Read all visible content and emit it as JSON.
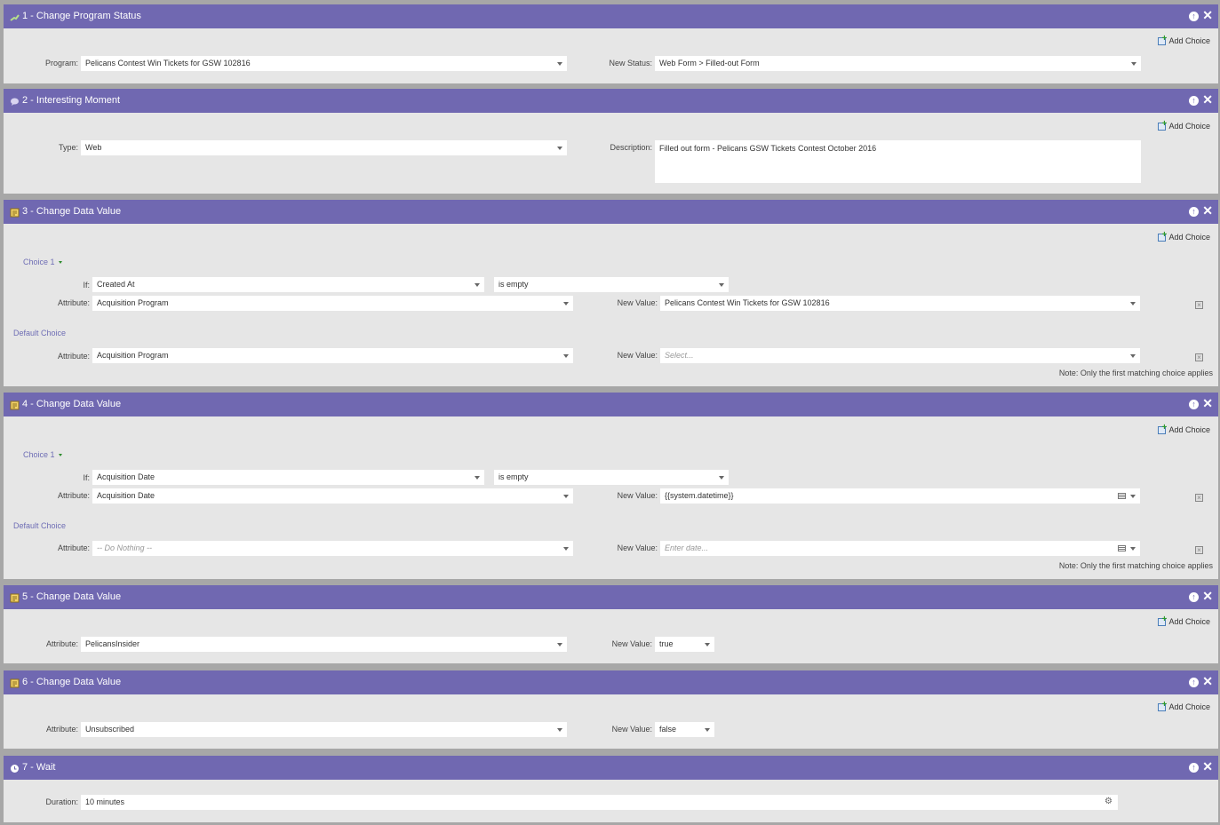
{
  "common": {
    "add_choice": "Add Choice",
    "note": "Note: Only the first matching choice applies"
  },
  "steps": [
    {
      "title": "1 - Change Program Status",
      "icon": "program-status-icon",
      "program_label": "Program:",
      "program_value": "Pelicans Contest Win Tickets for GSW 102816",
      "status_label": "New Status:",
      "status_value": "Web Form > Filled-out Form"
    },
    {
      "title": "2 - Interesting Moment",
      "icon": "speech-bubble-icon",
      "type_label": "Type:",
      "type_value": "Web",
      "desc_label": "Description:",
      "desc_value": "Filled out form - Pelicans GSW Tickets Contest October 2016"
    },
    {
      "title": "3 - Change Data Value",
      "icon": "data-value-icon",
      "choice_label": "Choice 1",
      "if_label": "If:",
      "if_value": "Created At",
      "op_value": "is empty",
      "attr_label": "Attribute:",
      "attr_value": "Acquisition Program",
      "newval_label": "New Value:",
      "newval_value": "Pelicans Contest Win Tickets for GSW 102816",
      "default_label": "Default Choice",
      "def_attr_value": "Acquisition Program",
      "def_newval_placeholder": "Select..."
    },
    {
      "title": "4 - Change Data Value",
      "icon": "data-value-icon",
      "choice_label": "Choice 1",
      "if_label": "If:",
      "if_value": "Acquisition Date",
      "op_value": "is empty",
      "attr_label": "Attribute:",
      "attr_value": "Acquisition Date",
      "newval_label": "New Value:",
      "newval_value": "{{system.datetime}}",
      "default_label": "Default Choice",
      "def_attr_value": "-- Do Nothing --",
      "def_newval_placeholder": "Enter date..."
    },
    {
      "title": "5 - Change Data Value",
      "icon": "data-value-icon",
      "attr_label": "Attribute:",
      "attr_value": "PelicansInsider",
      "newval_label": "New Value:",
      "newval_value": "true"
    },
    {
      "title": "6 - Change Data Value",
      "icon": "data-value-icon",
      "attr_label": "Attribute:",
      "attr_value": "Unsubscribed",
      "newval_label": "New Value:",
      "newval_value": "false"
    },
    {
      "title": "7 - Wait",
      "icon": "clock-icon",
      "duration_label": "Duration:",
      "duration_value": "10 minutes"
    }
  ]
}
